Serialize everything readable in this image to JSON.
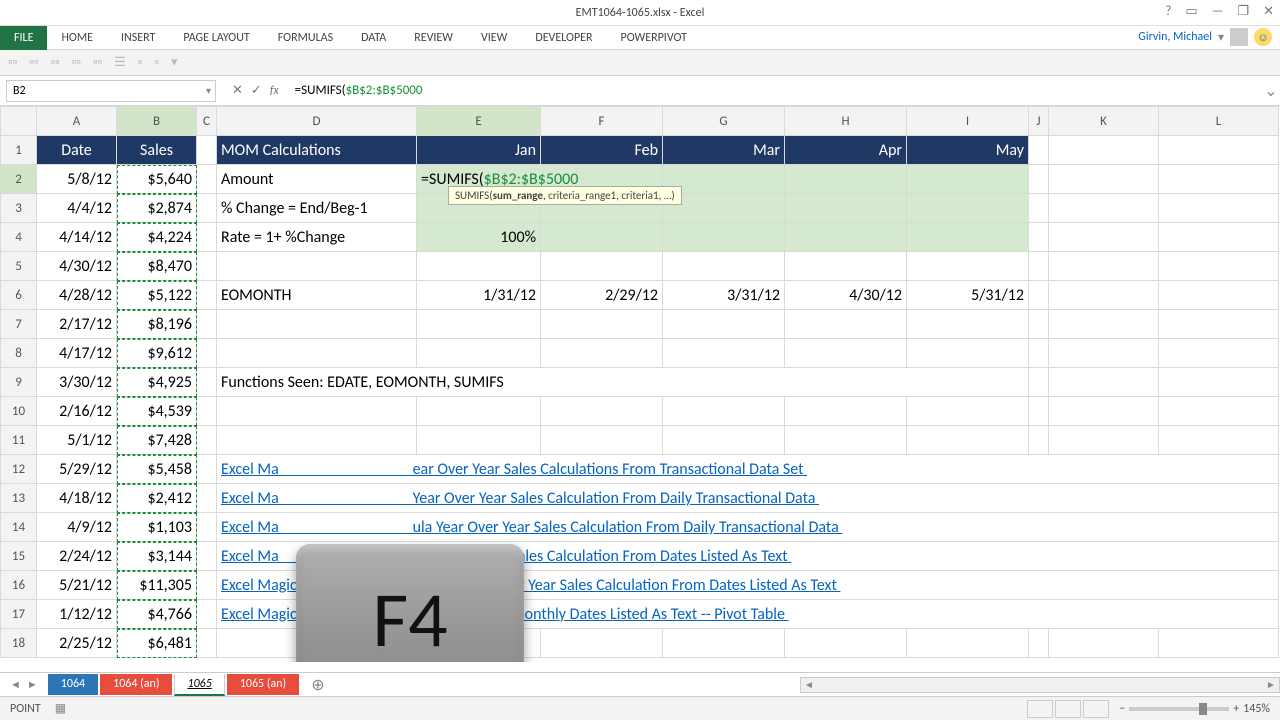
{
  "window": {
    "title": "EMT1064-1065.xlsx - Excel",
    "help": "?",
    "ribbonopts": "▭",
    "min": "—",
    "restore": "❐",
    "close": "✕"
  },
  "tabs": {
    "file": "FILE",
    "home": "HOME",
    "insert": "INSERT",
    "page": "PAGE LAYOUT",
    "formulas": "FORMULAS",
    "data": "DATA",
    "review": "REVIEW",
    "view": "VIEW",
    "developer": "DEVELOPER",
    "powerpivot": "POWERPIVOT"
  },
  "user": {
    "name": "Girvin, Michael"
  },
  "fbar": {
    "namebox": "B2",
    "cancel": "✕",
    "enter": "✓",
    "fx": "fx",
    "formula_prefix": "=SUMIFS(",
    "formula_ref": "$B$2:$B$5000"
  },
  "tooltip": {
    "fn": "SUMIFS(",
    "bold": "sum_range",
    "rest": ", criteria_range1, criteria1, …)"
  },
  "cols": [
    "A",
    "B",
    "C",
    "D",
    "E",
    "F",
    "G",
    "H",
    "I",
    "J",
    "K",
    "L"
  ],
  "headers": {
    "A": "Date",
    "B": "Sales",
    "D": "MOM Calculations",
    "E": "Jan",
    "F": "Feb",
    "G": "Mar",
    "H": "Apr",
    "I": "May"
  },
  "rows": [
    {
      "r": 2,
      "A": "5/8/12",
      "B": "$5,640",
      "D": "Amount"
    },
    {
      "r": 3,
      "A": "4/4/12",
      "B": "$2,874",
      "D": "% Change = End/Beg-1"
    },
    {
      "r": 4,
      "A": "4/14/12",
      "B": "$4,224",
      "D": "Rate = 1+ %Change",
      "E": "100%"
    },
    {
      "r": 5,
      "A": "4/30/12",
      "B": "$8,470"
    },
    {
      "r": 6,
      "A": "4/28/12",
      "B": "$5,122",
      "D": "EOMONTH",
      "E": "1/31/12",
      "F": "2/29/12",
      "G": "3/31/12",
      "H": "4/30/12",
      "I": "5/31/12"
    },
    {
      "r": 7,
      "A": "2/17/12",
      "B": "$8,196"
    },
    {
      "r": 8,
      "A": "4/17/12",
      "B": "$9,612"
    },
    {
      "r": 9,
      "A": "3/30/12",
      "B": "$4,925",
      "D": "Functions Seen: EDATE, EOMONTH, SUMIFS"
    },
    {
      "r": 10,
      "A": "2/16/12",
      "B": "$4,539"
    },
    {
      "r": 11,
      "A": "5/1/12",
      "B": "$7,428"
    },
    {
      "r": 12,
      "A": "5/29/12",
      "B": "$5,458",
      "link": "Excel Ma                                     ear Over Year Sales Calculations From Transactional Data Set "
    },
    {
      "r": 13,
      "A": "4/18/12",
      "B": "$2,412",
      "link": "Excel Ma                                     Year Over Year Sales Calculation From Daily Transactional Data "
    },
    {
      "r": 14,
      "A": "4/9/12",
      "B": "$1,103",
      "link": "Excel Ma                                     ula Year Over Year Sales Calculation From Daily Transactional Data "
    },
    {
      "r": 15,
      "A": "2/24/12",
      "B": "$3,144",
      "link": "Excel Ma                                     Year Over Year Sales Calculation From Dates Listed As Text "
    },
    {
      "r": 16,
      "A": "5/21/12",
      "B": "$11,305",
      "link": "Excel Magic Trick 613: Array Formula Year Over Year Sales Calculation From Dates Listed As Text "
    },
    {
      "r": 17,
      "A": "1/12/12",
      "B": "$4,766",
      "link": "Excel Magic Trick 614: Extract Full Date from Monthly Dates Listed As Text -- Pivot Table "
    },
    {
      "r": 18,
      "A": "2/25/12",
      "B": "$6,481"
    }
  ],
  "editcell": {
    "prefix": "=SUMIFS(",
    "ref": "$B$2:$B$5000"
  },
  "sheets": {
    "t1": "1064",
    "t2": "1064 (an)",
    "t3": "1065",
    "t4": "1065 (an)"
  },
  "status": {
    "mode": "POINT",
    "zoom": "145%"
  },
  "key": {
    "label": "F4"
  }
}
